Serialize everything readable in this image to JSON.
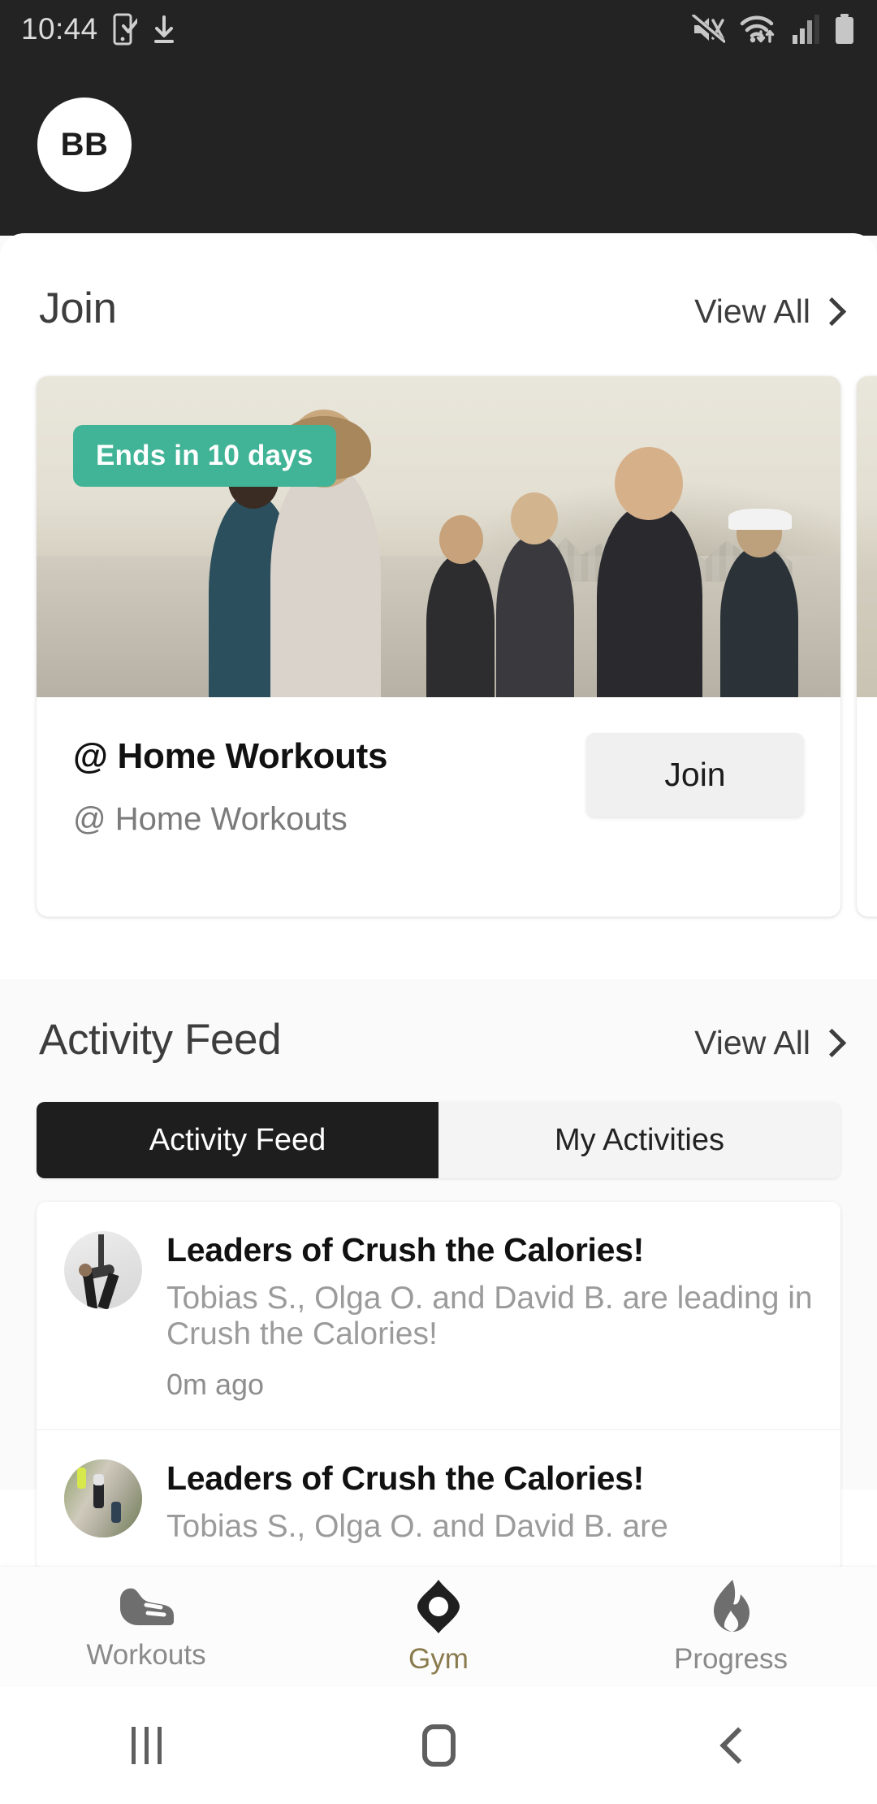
{
  "status_bar": {
    "time": "10:44",
    "left_icons": [
      "device-check-icon",
      "download-icon"
    ],
    "right_icons": [
      "mute-icon",
      "wifi-icon",
      "signal-icon",
      "battery-icon"
    ]
  },
  "header": {
    "avatar_initials": "BB",
    "background_color": "#232323"
  },
  "join_section": {
    "title": "Join",
    "view_all_label": "View All",
    "cards": [
      {
        "badge": "Ends in 10 days",
        "title": "@ Home Workouts",
        "subtitle": "@ Home Workouts",
        "action_label": "Join"
      }
    ]
  },
  "activity_section": {
    "title": "Activity Feed",
    "view_all_label": "View All",
    "tabs": [
      {
        "label": "Activity Feed",
        "active": true
      },
      {
        "label": "My Activities",
        "active": false
      }
    ],
    "items": [
      {
        "title": "Leaders of Crush the Calories!",
        "description": "Tobias S., Olga O. and David B. are leading in Crush the Calories!",
        "time": "0m ago",
        "avatar": "yoga-photo"
      },
      {
        "title": "Leaders of Crush the Calories!",
        "description": "Tobias S., Olga O. and David B. are",
        "time": "",
        "avatar": "running-photo"
      }
    ]
  },
  "bottom_nav": {
    "items": [
      {
        "label": "Workouts",
        "icon": "shoe-icon",
        "active": false
      },
      {
        "label": "Gym",
        "icon": "gym-diamond-icon",
        "active": true
      },
      {
        "label": "Progress",
        "icon": "flame-icon",
        "active": false
      }
    ],
    "active_color": "#8a7b4e",
    "inactive_color": "#8a8a8a"
  },
  "android_nav": {
    "recents_label": "Recents",
    "home_label": "Home",
    "back_label": "Back"
  },
  "colors": {
    "badge_green": "#41b396",
    "dark_header": "#232323",
    "tab_active": "#1e1e1e",
    "page_background": "#fafafa"
  }
}
